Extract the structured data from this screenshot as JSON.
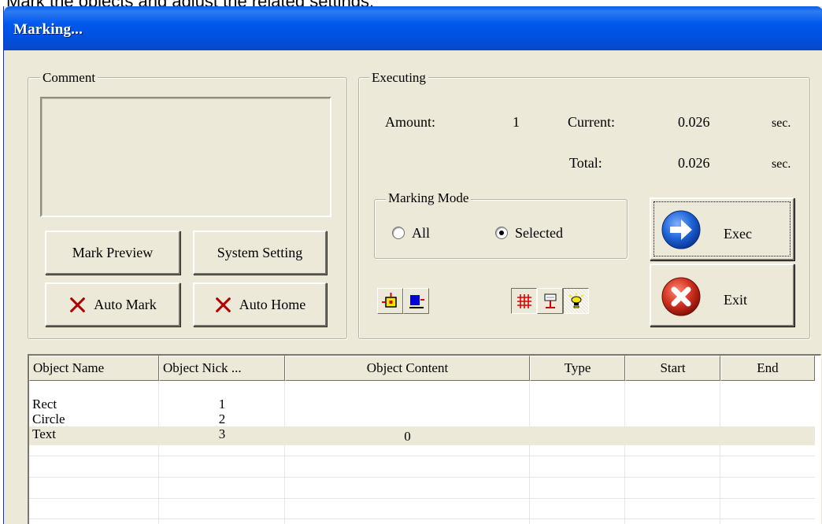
{
  "caption": "Mark the objects and adjust the related settings.",
  "window": {
    "title": "Marking..."
  },
  "comment": {
    "legend": "Comment",
    "text": ""
  },
  "buttons": {
    "mark_preview": "Mark Preview",
    "system_setting": "System Setting",
    "auto_mark": "Auto Mark",
    "auto_home": "Auto Home",
    "exec": "Exec",
    "exit": "Exit"
  },
  "executing": {
    "legend": "Executing",
    "amount_label": "Amount:",
    "amount_value": "1",
    "current_label": "Current:",
    "current_value": "0.026",
    "current_unit": "sec.",
    "total_label": "Total:",
    "total_value": "0.026",
    "total_unit": "sec."
  },
  "marking_mode": {
    "legend": "Marking Mode",
    "options": [
      "All",
      "Selected"
    ],
    "selected": "Selected"
  },
  "toolbar_icons": [
    "object-frame-icon",
    "object-align-icon",
    "grid-icon",
    "marker-head-icon",
    "light-icon"
  ],
  "table": {
    "columns": [
      "Object Name",
      "Object Nick ...",
      "Object Content",
      "Type",
      "Start",
      "End"
    ],
    "rows": [
      [
        "Rect",
        "1",
        "",
        "",
        "",
        ""
      ],
      [
        "Circle",
        "2",
        "",
        "",
        "",
        ""
      ],
      [
        "Text",
        "3",
        "0",
        "",
        "",
        ""
      ]
    ],
    "selected_row": 2
  },
  "colors": {
    "titlebar": "#0058ee",
    "face": "#ece9d8",
    "exec_icon": "#1f63d6",
    "exit_icon": "#d03020"
  }
}
